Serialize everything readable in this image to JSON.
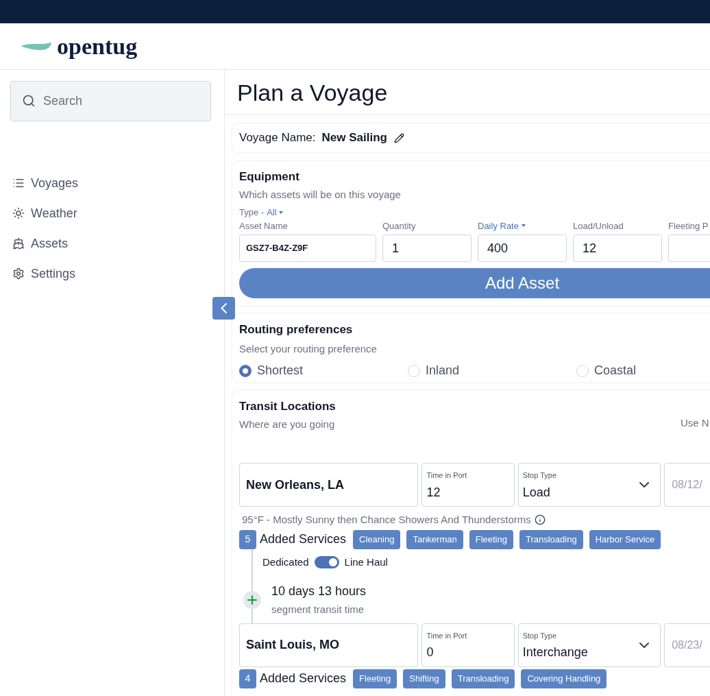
{
  "logo": {
    "text": "opentug"
  },
  "sidebar": {
    "search": {
      "placeholder": "Search"
    },
    "items": [
      {
        "label": "Voyages"
      },
      {
        "label": "Weather"
      },
      {
        "label": "Assets"
      },
      {
        "label": "Settings"
      }
    ]
  },
  "page_title": "Plan a Voyage",
  "voyage_name": {
    "label": "Voyage Name:",
    "value": "New Sailing"
  },
  "equipment": {
    "title": "Equipment",
    "subtitle": "Which assets will be on this voyage",
    "type_label": "Type -",
    "type_value": "All",
    "columns": [
      {
        "label": "Asset Name",
        "value": "GSZ7-B4Z-Z9F",
        "dropdown": false
      },
      {
        "label": "Quantity",
        "value": "1",
        "dropdown": false
      },
      {
        "label": "Daily Rate",
        "value": "400",
        "dropdown": true
      },
      {
        "label": "Load/Unload",
        "value": "12",
        "dropdown": false
      },
      {
        "label": "Fleeting P",
        "dropdown": false
      }
    ],
    "button": "Add Asset"
  },
  "routing": {
    "title": "Routing preferences",
    "subtitle": "Select your routing preference",
    "options": [
      {
        "label": "Shortest",
        "selected": true
      },
      {
        "label": "Inland",
        "selected": false
      },
      {
        "label": "Coastal",
        "selected": false
      }
    ]
  },
  "transit": {
    "title": "Transit Locations",
    "subtitle": "Where are you going",
    "right_text": "Use N",
    "stops": [
      {
        "location": "New Orleans, LA",
        "time_label": "Time in Port",
        "time_value": "12",
        "stop_type_label": "Stop Type",
        "stop_type": "Load",
        "date": "08/12/",
        "weather": "95°F - Mostly Sunny then Chance Showers And Thunderstorms",
        "services_count": "5",
        "services_label": "Added Services",
        "services": [
          "Cleaning",
          "Tankerman",
          "Fleeting",
          "Transloading",
          "Harbor Service"
        ],
        "line_haul": {
          "left": "Dedicated",
          "right": "Line Haul",
          "on": true
        },
        "segment": {
          "duration": "10 days 13 hours",
          "caption": "segment transit time"
        }
      },
      {
        "location": "Saint Louis, MO",
        "time_label": "Time in Port",
        "time_value": "0",
        "stop_type_label": "Stop Type",
        "stop_type": "Interchange",
        "date": "08/23/",
        "services_count": "4",
        "services_label": "Added Services",
        "services": [
          "Fleeting",
          "Shifting",
          "Transloading",
          "Covering Handling"
        ]
      }
    ]
  }
}
